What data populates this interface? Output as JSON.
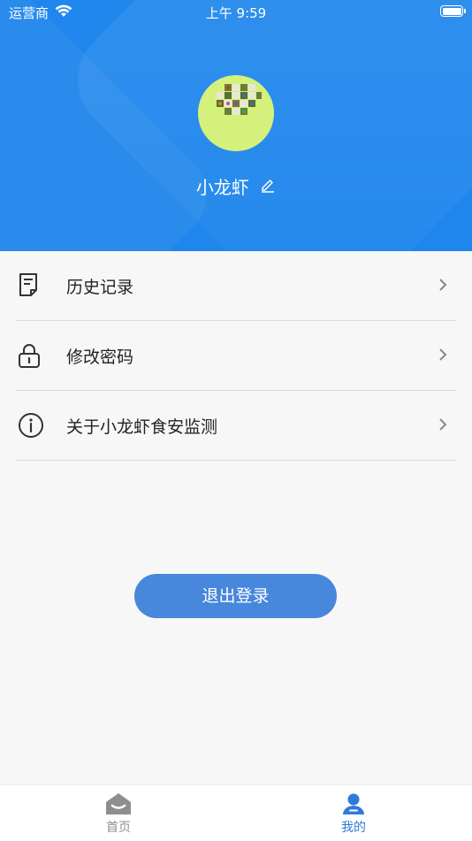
{
  "status_bar": {
    "carrier": "运营商",
    "time": "上午 9:59"
  },
  "profile": {
    "username": "小龙虾"
  },
  "menu": {
    "items": [
      {
        "label": "历史记录",
        "icon": "document-icon"
      },
      {
        "label": "修改密码",
        "icon": "lock-icon"
      },
      {
        "label": "关于小龙虾食安监测",
        "icon": "info-icon"
      }
    ]
  },
  "logout_label": "退出登录",
  "tabbar": {
    "home_label": "首页",
    "me_label": "我的"
  },
  "colors": {
    "header": "#1e86ec",
    "accent": "#2f7ad9",
    "button": "#4787dc"
  }
}
